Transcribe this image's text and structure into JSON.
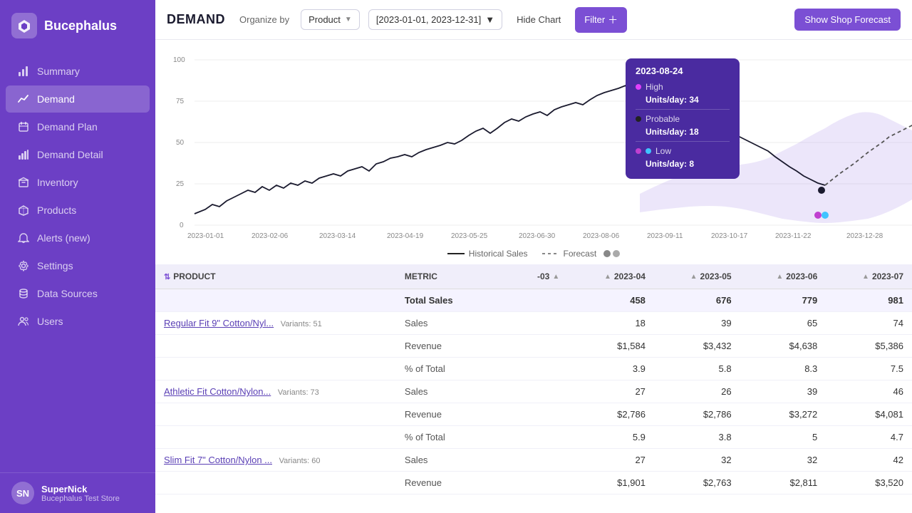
{
  "app": {
    "name": "Bucephalus"
  },
  "sidebar": {
    "items": [
      {
        "id": "summary",
        "label": "Summary",
        "icon": "chart-bar"
      },
      {
        "id": "demand",
        "label": "Demand",
        "icon": "trending-up"
      },
      {
        "id": "demand-plan",
        "label": "Demand Plan",
        "icon": "calendar"
      },
      {
        "id": "demand-detail",
        "label": "Demand Detail",
        "icon": "bar-chart"
      },
      {
        "id": "inventory",
        "label": "Inventory",
        "icon": "box"
      },
      {
        "id": "products",
        "label": "Products",
        "icon": "tag"
      },
      {
        "id": "alerts",
        "label": "Alerts (new)",
        "icon": "bell"
      },
      {
        "id": "settings",
        "label": "Settings",
        "icon": "gear"
      },
      {
        "id": "data-sources",
        "label": "Data Sources",
        "icon": "database"
      },
      {
        "id": "users",
        "label": "Users",
        "icon": "users"
      }
    ],
    "active": "demand",
    "user": {
      "name": "SuperNick",
      "store": "Bucephalus Test Store",
      "initials": "SN"
    }
  },
  "header": {
    "title": "DEMAND",
    "organize_by_label": "Organize by",
    "organize_by_value": "Product",
    "date_range": "[2023-01-01, 2023-12-31]",
    "hide_chart_label": "Hide Chart",
    "filter_label": "Filter",
    "show_forecast_label": "Show Shop Forecast"
  },
  "chart": {
    "y_labels": [
      "100",
      "75",
      "50",
      "25",
      "0"
    ],
    "x_labels": [
      "2023-01-01",
      "2023-02-06",
      "2023-03-14",
      "2023-04-19",
      "2023-05-25",
      "2023-06-30",
      "2023-08-06",
      "2023-09-11",
      "2023-10-17",
      "2023-11-22",
      "2023-12-28"
    ],
    "legend": {
      "historical_label": "Historical Sales",
      "forecast_label": "Forecast"
    },
    "tooltip": {
      "date": "2023-08-24",
      "high_label": "High",
      "high_value": "Units/day: 34",
      "high_color": "#e040fb",
      "probable_label": "Probable",
      "probable_value": "Units/day: 18",
      "probable_color": "#222",
      "low_label": "Low",
      "low_value": "Units/day: 8",
      "low_color": "#40c4ff"
    }
  },
  "table": {
    "columns": [
      {
        "id": "product",
        "label": "PRODUCT"
      },
      {
        "id": "metric",
        "label": "METRIC"
      },
      {
        "id": "col_minus03",
        "label": "-03"
      },
      {
        "id": "col_2023_04",
        "label": "2023-04"
      },
      {
        "id": "col_2023_05",
        "label": "2023-05"
      },
      {
        "id": "col_2023_06",
        "label": "2023-06"
      },
      {
        "id": "col_2023_07",
        "label": "2023-07"
      }
    ],
    "total_row": {
      "label": "Total Sales",
      "values": [
        "",
        "458",
        "676",
        "779",
        "981"
      ]
    },
    "rows": [
      {
        "product": "Regular Fit 9\" Cotton/Nyl...",
        "variants": "Variants: 51",
        "metrics": [
          {
            "metric": "Sales",
            "values": [
              "18",
              "39",
              "65",
              "74"
            ]
          },
          {
            "metric": "Revenue",
            "values": [
              "$1,584",
              "$3,432",
              "$4,638",
              "$5,386"
            ]
          },
          {
            "metric": "% of Total",
            "values": [
              "3.9",
              "5.8",
              "8.3",
              "7.5"
            ]
          }
        ]
      },
      {
        "product": "Athletic Fit Cotton/Nylon...",
        "variants": "Variants: 73",
        "metrics": [
          {
            "metric": "Sales",
            "values": [
              "27",
              "26",
              "39",
              "46"
            ]
          },
          {
            "metric": "Revenue",
            "values": [
              "$2,786",
              "$2,786",
              "$3,272",
              "$4,081"
            ]
          },
          {
            "metric": "% of Total",
            "values": [
              "5.9",
              "3.8",
              "5",
              "4.7"
            ]
          }
        ]
      },
      {
        "product": "Slim Fit 7\" Cotton/Nylon ...",
        "variants": "Variants: 60",
        "metrics": [
          {
            "metric": "Sales",
            "values": [
              "27",
              "32",
              "32",
              "42"
            ]
          },
          {
            "metric": "Revenue",
            "values": [
              "$1,901",
              "$2,763",
              "$2,811",
              "$3,520"
            ]
          }
        ]
      }
    ]
  }
}
